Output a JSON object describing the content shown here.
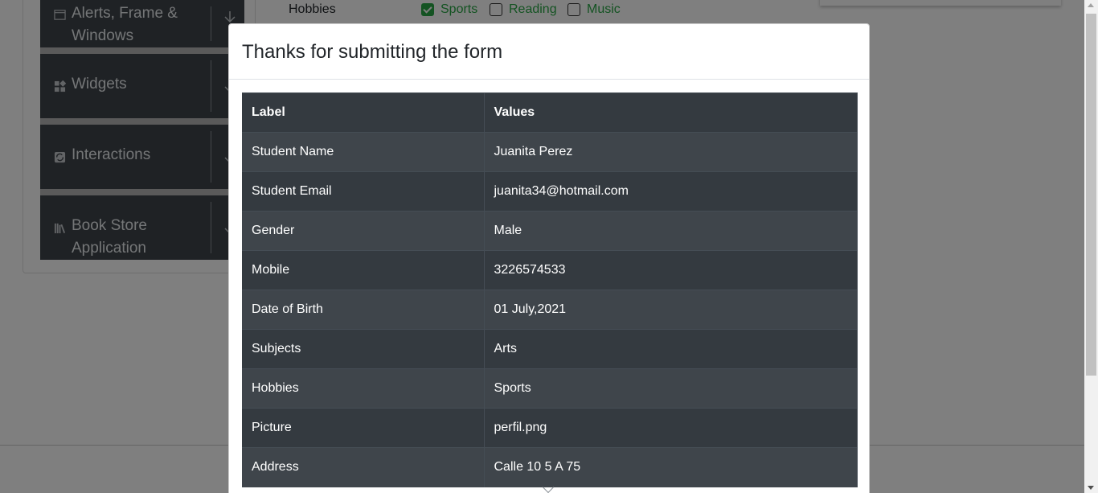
{
  "sidebar": {
    "groups": [
      {
        "label": "Alerts, Frame & Windows",
        "icon": "window-icon"
      },
      {
        "label": "Widgets",
        "icon": "widgets-icon"
      },
      {
        "label": "Interactions",
        "icon": "interactions-icon"
      },
      {
        "label": "Book Store Application",
        "icon": "books-icon"
      }
    ]
  },
  "form": {
    "hobbies_label": "Hobbies",
    "hobbies": [
      {
        "label": "Sports",
        "checked": true
      },
      {
        "label": "Reading",
        "checked": false
      },
      {
        "label": "Music",
        "checked": false
      }
    ]
  },
  "modal": {
    "title": "Thanks for submitting the form",
    "columns": [
      "Label",
      "Values"
    ],
    "rows": [
      [
        "Student Name",
        "Juanita Perez"
      ],
      [
        "Student Email",
        "juanita34@hotmail.com"
      ],
      [
        "Gender",
        "Male"
      ],
      [
        "Mobile",
        "3226574533"
      ],
      [
        "Date of Birth",
        "01 July,2021"
      ],
      [
        "Subjects",
        "Arts"
      ],
      [
        "Hobbies",
        "Sports"
      ],
      [
        "Picture",
        "perfil.png"
      ],
      [
        "Address",
        "Calle 10 5 A 75"
      ]
    ]
  },
  "colors": {
    "accent": "#28a745",
    "table_dark": "#343a40",
    "table_stripe": "#3f454b",
    "backdrop": "rgba(0,0,0,0.5)"
  }
}
